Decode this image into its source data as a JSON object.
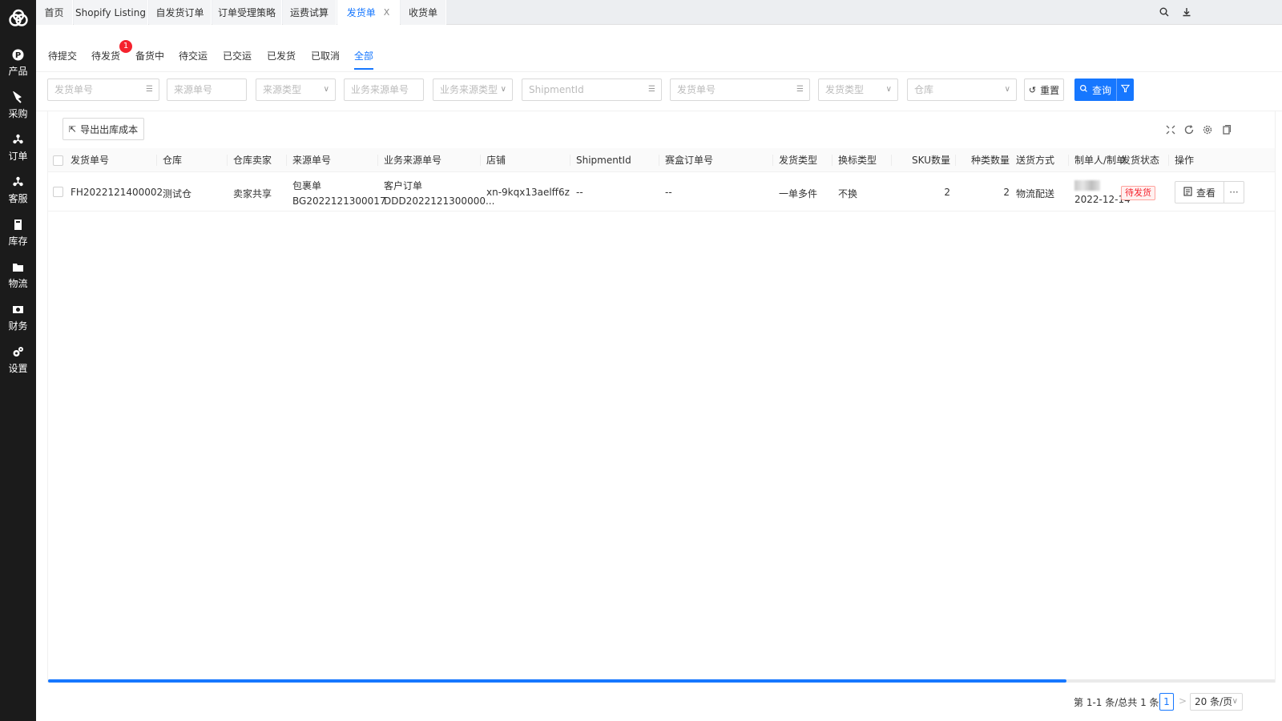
{
  "sidebar": {
    "items": [
      {
        "icon": "product-icon",
        "label": "产品"
      },
      {
        "icon": "purchase-icon",
        "label": "采购"
      },
      {
        "icon": "order-icon",
        "label": "订单"
      },
      {
        "icon": "customer-service-icon",
        "label": "客服"
      },
      {
        "icon": "inventory-icon",
        "label": "库存"
      },
      {
        "icon": "logistics-icon",
        "label": "物流"
      },
      {
        "icon": "finance-icon",
        "label": "财务"
      },
      {
        "icon": "settings-icon",
        "label": "设置"
      }
    ]
  },
  "top_tabs": [
    {
      "label": "首页"
    },
    {
      "label": "Shopify Listing"
    },
    {
      "label": "自发货订单"
    },
    {
      "label": "订单受理策略"
    },
    {
      "label": "运费试算"
    },
    {
      "label": "发货单",
      "active": true,
      "closable": true,
      "close_label": "X"
    },
    {
      "label": "收货单"
    }
  ],
  "status_tabs": [
    {
      "label": "待提交"
    },
    {
      "label": "待发货",
      "badge": "1"
    },
    {
      "label": "备货中"
    },
    {
      "label": "待交运"
    },
    {
      "label": "已交运"
    },
    {
      "label": "已发货"
    },
    {
      "label": "已取消"
    },
    {
      "label": "全部",
      "active": true
    }
  ],
  "filters": [
    {
      "placeholder": "发货单号",
      "kind": "text-list"
    },
    {
      "placeholder": "来源单号",
      "kind": "text"
    },
    {
      "placeholder": "来源类型",
      "kind": "select"
    },
    {
      "placeholder": "业务来源单号",
      "kind": "text"
    },
    {
      "placeholder": "业务来源类型",
      "kind": "select"
    },
    {
      "placeholder": "ShipmentId",
      "kind": "text-list"
    },
    {
      "placeholder": "发货单号",
      "kind": "text-list"
    },
    {
      "placeholder": "发货类型",
      "kind": "select"
    },
    {
      "placeholder": "仓库",
      "kind": "select"
    }
  ],
  "buttons": {
    "reset": "重置",
    "search": "查询",
    "export": "导出出库成本",
    "view": "查看",
    "more": "···"
  },
  "table": {
    "headers": [
      "发货单号",
      "仓库",
      "仓库卖家",
      "来源单号",
      "业务来源单号",
      "店铺",
      "ShipmentId",
      "赛盒订单号",
      "发货类型",
      "换标类型",
      "SKU数量",
      "种类数量",
      "送货方式",
      "制单人/制单",
      "发货状态",
      "操作"
    ],
    "rows": [
      {
        "ship_no": "FH2022121400002",
        "warehouse": "测试仓",
        "seller": "卖家共享",
        "source_type": "包裹单",
        "source_no": "BG2022121300017",
        "biz_type": "客户订单",
        "biz_no": "DDD2022121300000...",
        "store": "xn-9kqx13aelff6z",
        "shipment_id": "--",
        "saihe_no": "--",
        "ship_type": "一单多件",
        "label_type": "不换",
        "sku_qty": "2",
        "kind_qty": "2",
        "delivery": "物流配送",
        "created_date": "2022-12-14",
        "status": "待发货"
      }
    ]
  },
  "pagination": {
    "total_text": "第 1-1 条/总共 1 条",
    "prev": "<",
    "current": "1",
    "next": ">",
    "page_size": "20 条/页",
    "scroll_fraction": 0.83
  },
  "colors": {
    "primary": "#1677ff",
    "sidebar": "#1b1b1b",
    "danger": "#f5222d"
  }
}
